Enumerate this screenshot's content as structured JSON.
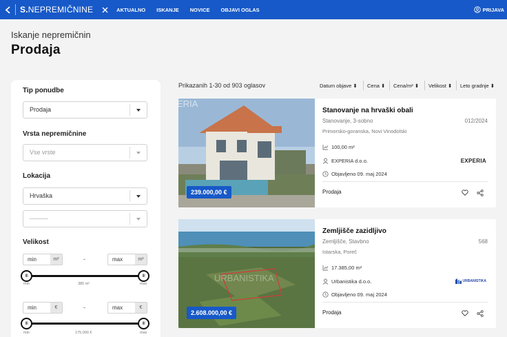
{
  "nav": {
    "logo_prefix": "S.",
    "logo_name": "NEPREMIČNINE",
    "links": [
      "AKTUALNO",
      "ISKANJE",
      "NOVICE",
      "OBJAVI OGLAS"
    ],
    "login": "PRIJAVA",
    "accent_color": "#1759c8"
  },
  "header": {
    "subtitle": "Iskanje nepremičnin",
    "title": "Prodaja"
  },
  "filters": {
    "offer_type_label": "Tip ponudbe",
    "offer_type_value": "Prodaja",
    "property_type_label": "Vrsta nepremičnine",
    "property_type_placeholder": "Vse vrste",
    "location_label": "Lokacija",
    "location_value": "Hrvaška",
    "sublocation_placeholder": "---------",
    "size_label": "Velikost",
    "size": {
      "min_placeholder": "min",
      "max_placeholder": "max",
      "unit": "m²",
      "min_end": "min",
      "max_end": "max",
      "range_label": "380 m²"
    },
    "price": {
      "min_placeholder": "min",
      "max_placeholder": "max",
      "unit": "€",
      "min_end": "min",
      "max_end": "max",
      "range_label": "175.000 €"
    },
    "thumb_glyph": "III"
  },
  "results": {
    "count_text": "Prikazanih 1-30 od 903 oglasov",
    "sort_options": [
      "Datum objave",
      "Cena",
      "Cena/m²",
      "Velikost",
      "Leto gradnje"
    ]
  },
  "listings": [
    {
      "title": "Stanovanje na hrvaški obali",
      "subtitle": "Stanovanje, 3-sobno",
      "ref": "012/2024",
      "location": "Primorsko-goranska, Novi Vinodolski",
      "area": "100,00 m²",
      "agency": "EXPERIA d.o.o.",
      "agency_logo": "EXPERIA",
      "published": "Objavljeno 09. maj 2024",
      "price": "239.000,00 €",
      "type": "Prodaja",
      "image_watermark": "ERIA"
    },
    {
      "title": "Zemljišče zazidljivo",
      "subtitle": "Zemljišče, Stavbno",
      "ref": "568",
      "location": "Istarska, Poreč",
      "area": "17.385,00 m²",
      "agency": "Urbanistika d.o.o.",
      "agency_logo": "URBANISTIKA",
      "published": "Objavljeno 09. maj 2024",
      "price": "2.608.000,00 €",
      "type": "Prodaja",
      "image_watermark": "URBANISTIKA"
    }
  ]
}
